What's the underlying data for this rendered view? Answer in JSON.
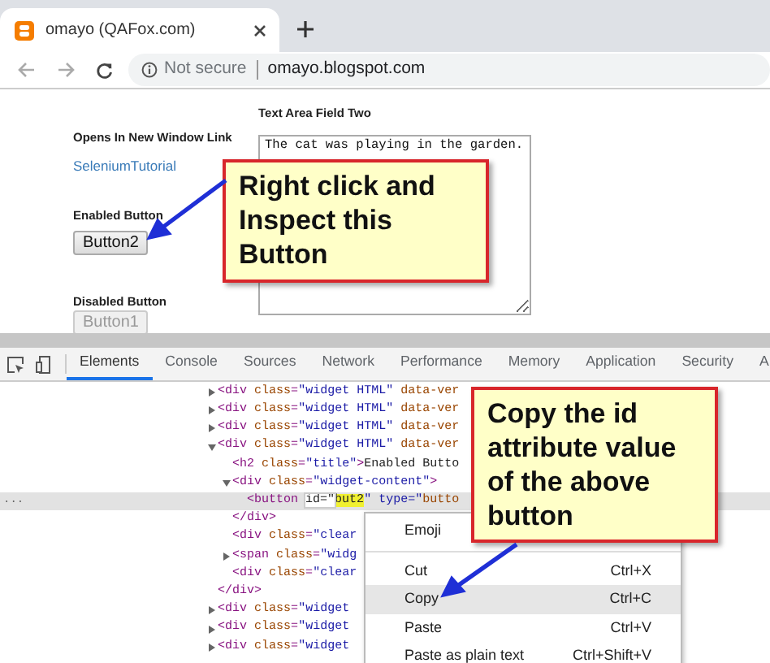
{
  "browser": {
    "tab": {
      "title": "omayo (QAFox.com)"
    },
    "address": {
      "security": "Not secure",
      "url": "omayo.blogspot.com"
    }
  },
  "page": {
    "textarea_label": "Text Area Field Two",
    "textarea_value": "The cat was playing in the garden.",
    "link_label": "Opens In New Window Link",
    "link": "SeleniumTutorial",
    "enabled_label": "Enabled Button",
    "enabled_button": {
      "label": "Button2",
      "disabled": false
    },
    "disabled_label": "Disabled Button",
    "disabled_button": {
      "label": "Button1",
      "disabled": true
    }
  },
  "devtools": {
    "tabs": [
      {
        "label": "Elements",
        "selected": true
      },
      {
        "label": "Console",
        "selected": false
      },
      {
        "label": "Sources",
        "selected": false
      },
      {
        "label": "Network",
        "selected": false
      },
      {
        "label": "Performance",
        "selected": false
      },
      {
        "label": "Memory",
        "selected": false
      },
      {
        "label": "Application",
        "selected": false
      },
      {
        "label": "Security",
        "selected": false
      },
      {
        "label": "A",
        "selected": false
      }
    ],
    "row_marker": "...",
    "tree": [
      {
        "text": "<div class=\"widget HTML\" data-ver",
        "expanded": false,
        "selected": false
      },
      {
        "text": "<div class=\"widget HTML\" data-ver",
        "expanded": false,
        "selected": false
      },
      {
        "text": "<div class=\"widget HTML\" data-ver",
        "expanded": false,
        "selected": false
      },
      {
        "text": "<div class=\"widget HTML\" data-ver",
        "expanded": true,
        "selected": false,
        "closing": "</div>",
        "children": [
          {
            "text": "<h2 class=\"title\">Enabled Butto",
            "selected": false
          },
          {
            "text": "<div class=\"widget-content\">",
            "expanded": true,
            "selected": false,
            "closing": "</div>",
            "children": [
              {
                "parts": [
                  {
                    "text": "<button ",
                    "kind": "code"
                  },
                  {
                    "text": "id=\"",
                    "kind": "boxed"
                  },
                  {
                    "text": "but2",
                    "kind": "highlight"
                  },
                  {
                    "text": "\" type=\"butto",
                    "kind": "code"
                  }
                ],
                "selected": true
              }
            ]
          },
          {
            "text": "<div class=\"clear",
            "selected": false
          },
          {
            "text": "<span class=\"widg",
            "expanded": false,
            "selected": false
          },
          {
            "text": "<div class=\"clear",
            "selected": false
          }
        ]
      },
      {
        "text": "<div class=\"widget",
        "expanded": false,
        "selected": false
      },
      {
        "text": "<div class=\"widget",
        "expanded": false,
        "selected": false
      },
      {
        "text": "<div class=\"widget",
        "expanded": false,
        "selected": false
      }
    ],
    "context_menu": [
      {
        "kind": "item",
        "label": "Emoji",
        "selected": false
      },
      {
        "kind": "separator"
      },
      {
        "kind": "item",
        "label": "Cut",
        "shortcut": "Ctrl+X",
        "selected": false
      },
      {
        "kind": "item",
        "label": "Copy",
        "shortcut": "Ctrl+C",
        "selected": true
      },
      {
        "kind": "item",
        "label": "Paste",
        "shortcut": "Ctrl+V",
        "selected": false
      },
      {
        "kind": "item",
        "label": "Paste as plain text",
        "shortcut": "Ctrl+Shift+V",
        "selected": false
      }
    ]
  },
  "callouts": [
    {
      "text": "Right click and\nInspect this\nButton"
    },
    {
      "text": "Copy the id\nattribute value\nof the above\nbutton"
    }
  ]
}
